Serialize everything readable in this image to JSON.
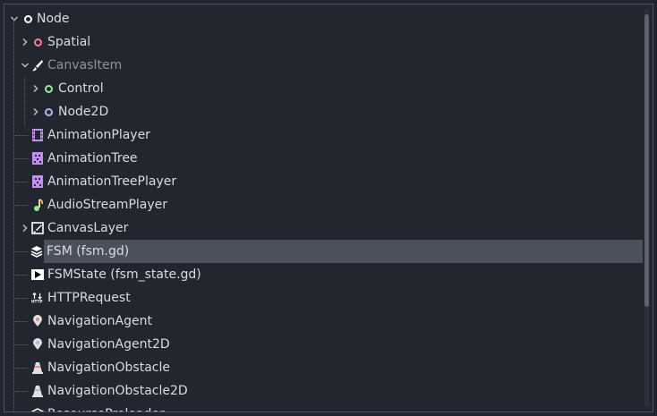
{
  "tree": {
    "items": [
      {
        "label": "Node",
        "icon": "node-circle-icon",
        "color": "#ffffff",
        "expanded": true,
        "depth": 0
      },
      {
        "label": "Spatial",
        "icon": "spatial-circle-icon",
        "color": "#fc7f7f",
        "expanded": false,
        "depth": 1
      },
      {
        "label": "CanvasItem",
        "icon": "brush-icon",
        "color": "#ffffff",
        "expanded": true,
        "depth": 1,
        "dim": true
      },
      {
        "label": "Control",
        "icon": "control-circle-icon",
        "color": "#8eef97",
        "expanded": false,
        "depth": 2
      },
      {
        "label": "Node2D",
        "icon": "node2d-circle-icon",
        "color": "#a5b7f3",
        "expanded": false,
        "depth": 2
      },
      {
        "label": "AnimationPlayer",
        "icon": "film-strip-icon",
        "color": "#c38ef1",
        "depth": 1
      },
      {
        "label": "AnimationTree",
        "icon": "animation-tree-icon",
        "color": "#c38ef1",
        "depth": 1
      },
      {
        "label": "AnimationTreePlayer",
        "icon": "animation-tree-player-icon",
        "color": "#c38ef1",
        "depth": 1
      },
      {
        "label": "AudioStreamPlayer",
        "icon": "music-note-icon",
        "color": "#e0e0e0",
        "depth": 1
      },
      {
        "label": "CanvasLayer",
        "icon": "canvas-layer-icon",
        "color": "#ffffff",
        "expanded": false,
        "depth": 1
      },
      {
        "label": "FSM (fsm.gd)",
        "icon": "layers-stack-icon",
        "color": "#ffffff",
        "depth": 1,
        "selected": true
      },
      {
        "label": "FSMState (fsm_state.gd)",
        "icon": "play-box-icon",
        "color": "#ffffff",
        "depth": 1
      },
      {
        "label": "HTTPRequest",
        "icon": "http-request-icon",
        "color": "#ffffff",
        "depth": 1
      },
      {
        "label": "NavigationAgent",
        "icon": "map-pin-3d-icon",
        "color": "#fc7f7f",
        "depth": 1
      },
      {
        "label": "NavigationAgent2D",
        "icon": "map-pin-2d-icon",
        "color": "#a5b7f3",
        "depth": 1
      },
      {
        "label": "NavigationObstacle",
        "icon": "cone-3d-icon",
        "color": "#fc7f7f",
        "depth": 1
      },
      {
        "label": "NavigationObstacle2D",
        "icon": "cone-2d-icon",
        "color": "#a5b7f3",
        "depth": 1
      },
      {
        "label": "ResourcePreloader",
        "icon": "resource-preloader-icon",
        "color": "#ffffff",
        "depth": 1
      }
    ]
  }
}
